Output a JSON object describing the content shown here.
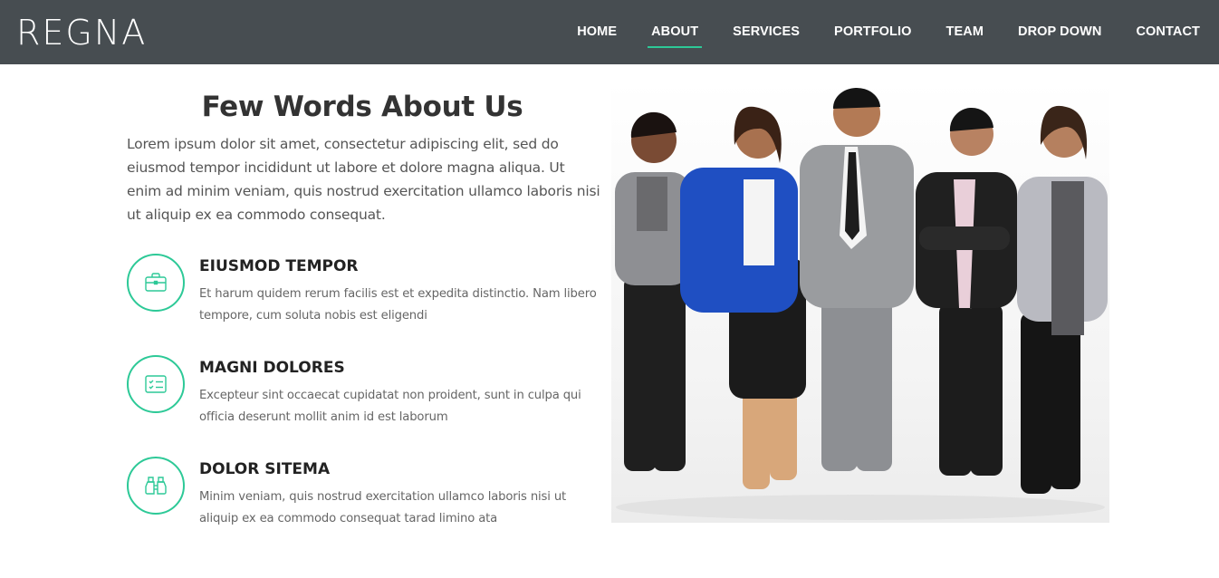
{
  "header": {
    "logo": "REGNA",
    "nav": [
      {
        "label": "HOME",
        "active": false
      },
      {
        "label": "ABOUT",
        "active": true
      },
      {
        "label": "SERVICES",
        "active": false
      },
      {
        "label": "PORTFOLIO",
        "active": false
      },
      {
        "label": "TEAM",
        "active": false
      },
      {
        "label": "DROP DOWN",
        "active": false
      },
      {
        "label": "CONTACT",
        "active": false
      }
    ]
  },
  "about": {
    "title": "Few Words About Us",
    "intro": "Lorem ipsum dolor sit amet, consectetur adipiscing elit, sed do eiusmod tempor incididunt ut labore et dolore magna aliqua. Ut enim ad minim veniam, quis nostrud exercitation ullamco laboris nisi ut aliquip ex ea commodo consequat.",
    "features": [
      {
        "icon": "briefcase-icon",
        "title": "EIUSMOD TEMPOR",
        "desc": "Et harum quidem rerum facilis est et expedita distinctio. Nam libero tempore, cum soluta nobis est eligendi"
      },
      {
        "icon": "card-checklist-icon",
        "title": "MAGNI DOLORES",
        "desc": "Excepteur sint occaecat cupidatat non proident, sunt in culpa qui officia deserunt mollit anim id est laborum"
      },
      {
        "icon": "binoculars-icon",
        "title": "DOLOR SITEMA",
        "desc": "Minim veniam, quis nostrud exercitation ullamco laboris nisi ut aliquip ex ea commodo consequat tarad limino ata"
      }
    ]
  },
  "colors": {
    "accent": "#2dc997",
    "header_bg": "#474d51"
  }
}
